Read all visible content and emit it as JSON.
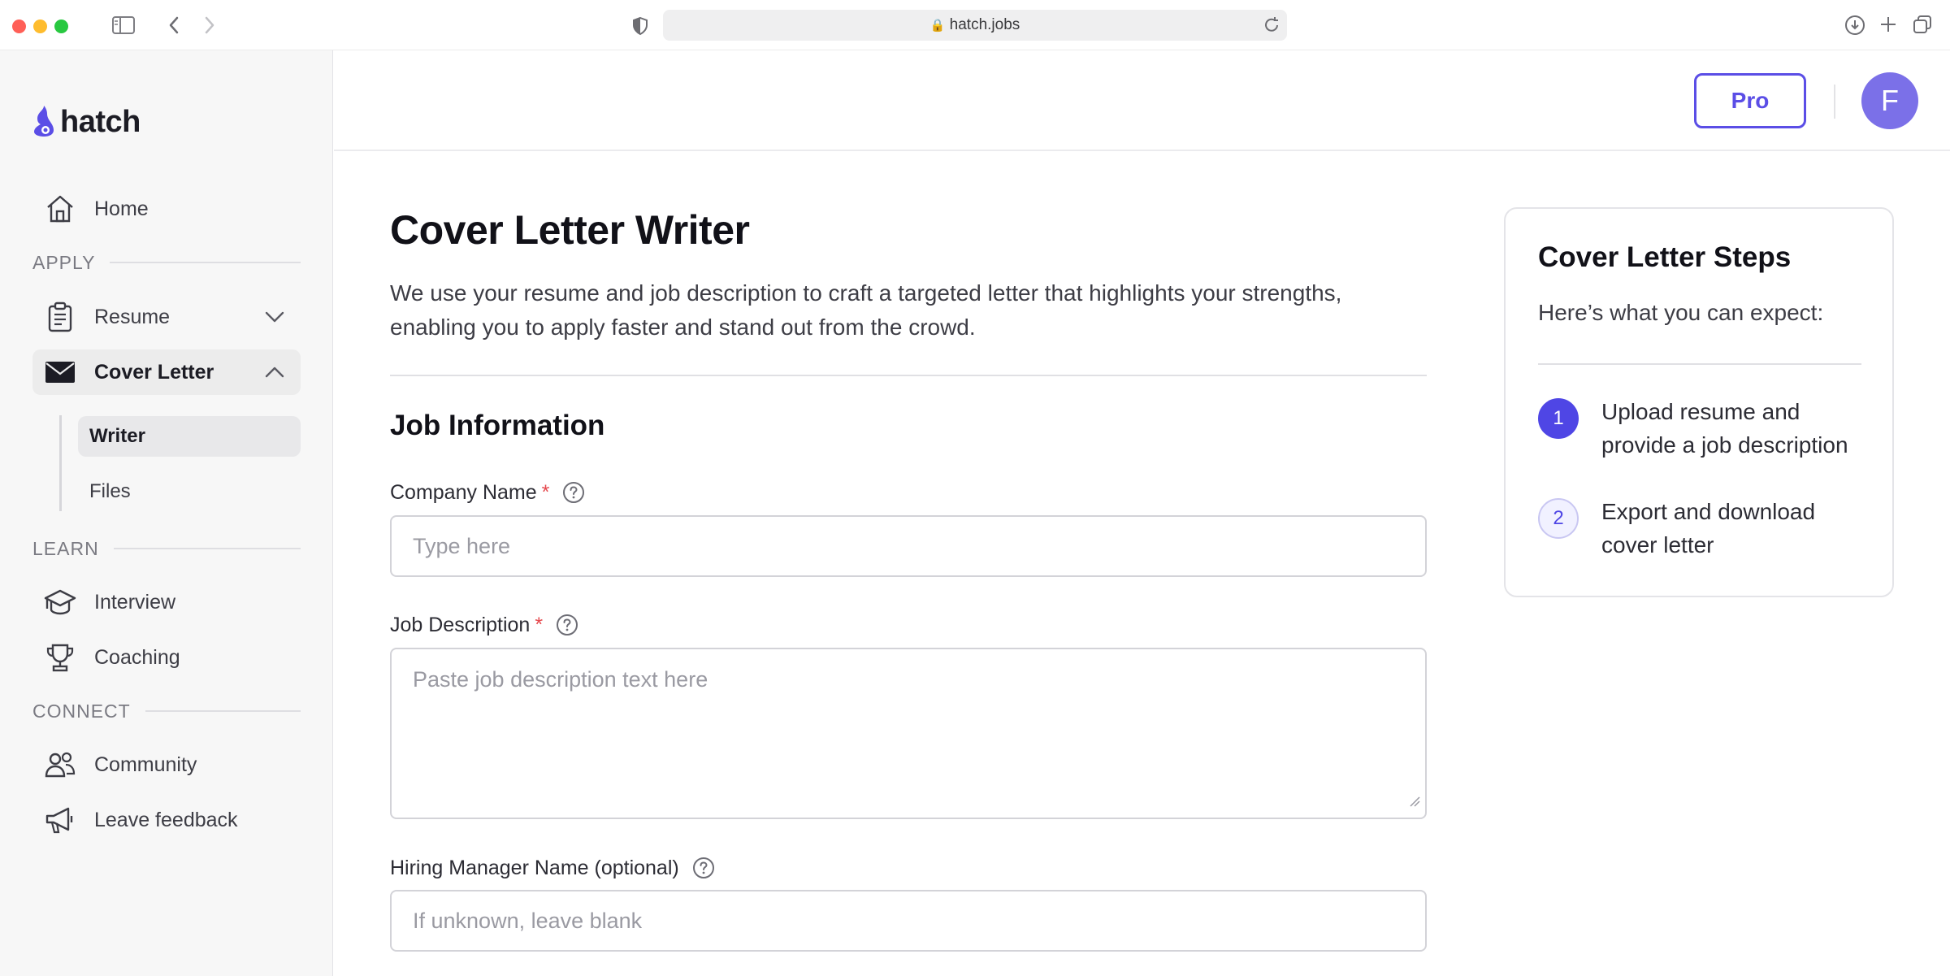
{
  "browser": {
    "url": "hatch.jobs",
    "colors": {
      "close": "#ff5f57",
      "minimize": "#febc2e",
      "maximize": "#28c840"
    }
  },
  "sidebar": {
    "logo_text": "hatch",
    "home_label": "Home",
    "sections": {
      "apply": "APPLY",
      "learn": "LEARN",
      "connect": "CONNECT"
    },
    "items": {
      "resume": "Resume",
      "cover_letter": "Cover Letter",
      "writer": "Writer",
      "files": "Files",
      "interview": "Interview",
      "coaching": "Coaching",
      "community": "Community",
      "feedback": "Leave feedback"
    }
  },
  "header": {
    "pro_label": "Pro",
    "avatar_initial": "F",
    "accent": "#5b4ee6"
  },
  "main": {
    "title": "Cover Letter Writer",
    "description_line1": "We use your resume and job description to craft a targeted letter that highlights your strengths,",
    "description_line2": "enabling you to apply faster and stand out from the crowd.",
    "section_title": "Job Information",
    "fields": {
      "company_label": "Company Name",
      "company_required": "*",
      "company_placeholder": "Type here",
      "job_desc_label": "Job Description",
      "job_desc_required": "*",
      "job_desc_placeholder": "Paste job description text here",
      "manager_label": "Hiring Manager Name (optional)",
      "manager_placeholder": "If unknown, leave blank"
    }
  },
  "steps_card": {
    "title": "Cover Letter Steps",
    "subtitle": "Here’s what you can expect:",
    "steps": [
      {
        "num": "1",
        "line1": "Upload resume and",
        "line2": "provide a job description"
      },
      {
        "num": "2",
        "line1": "Export and download",
        "line2": "cover letter"
      }
    ]
  }
}
